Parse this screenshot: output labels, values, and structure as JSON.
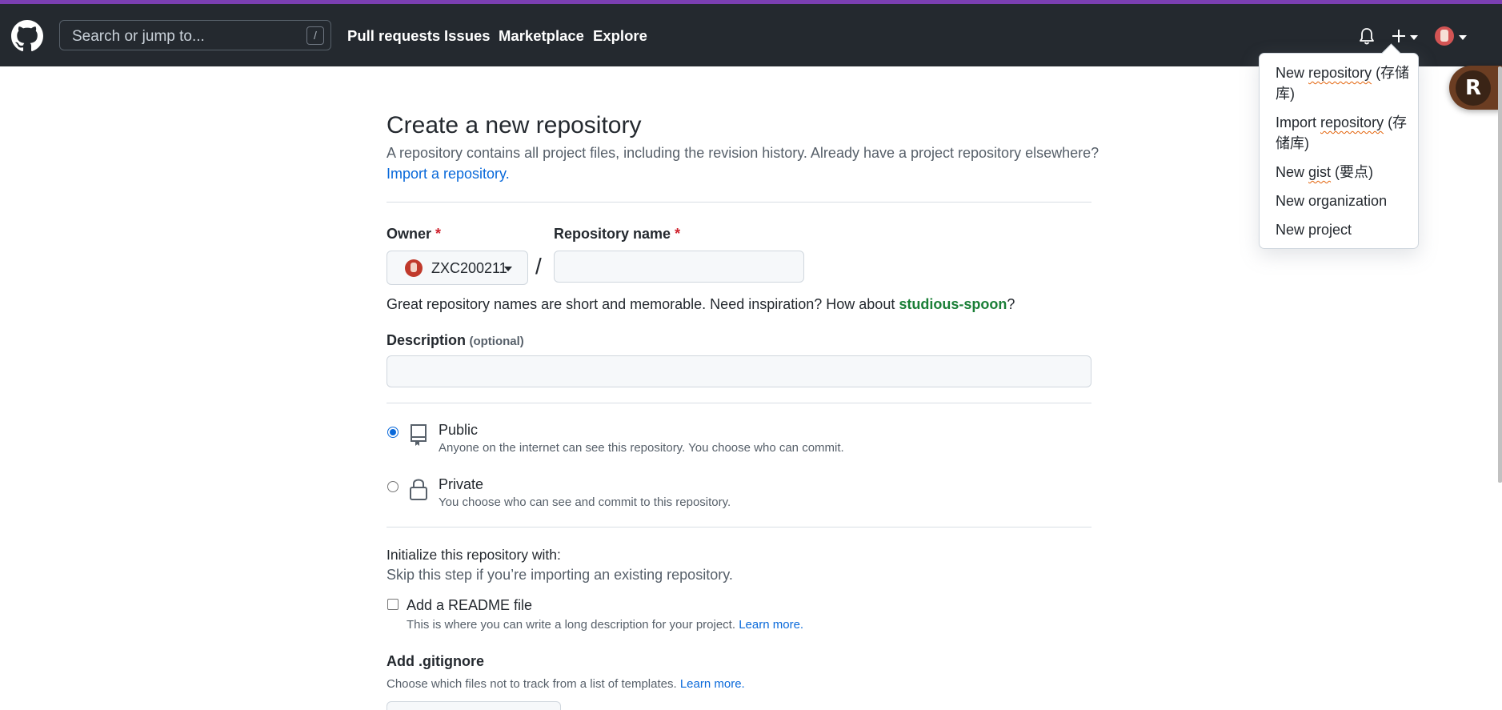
{
  "colors": {
    "header_bg": "#24292f",
    "accent_stripe": "#7b3fb2",
    "link": "#0969da",
    "suggestion": "#1a7f37",
    "required": "#cf222e"
  },
  "header": {
    "search_placeholder": "Search or jump to...",
    "search_shortcut": "/",
    "nav": [
      "Pull requests",
      "Issues",
      "Marketplace",
      "Explore"
    ],
    "icons": [
      "github-logo-icon",
      "bell-icon",
      "plus-icon",
      "avatar"
    ]
  },
  "dropdown": {
    "items": [
      {
        "label": "New",
        "sq": "repository",
        "rest": " (存储库)"
      },
      {
        "label": "Import",
        "sq": "repository",
        "rest": " (存储库)"
      },
      {
        "label": "New",
        "sq": "gist",
        "rest": " (要点)"
      },
      {
        "label": "New organization",
        "sq": "",
        "rest": ""
      },
      {
        "label": "New project",
        "sq": "",
        "rest": ""
      }
    ]
  },
  "badge": {
    "letter": "R"
  },
  "main": {
    "title": "Create a new repository",
    "subtitle": "A repository contains all project files, including the revision history. Already have a project repository elsewhere?",
    "import_link": "Import a repository.",
    "owner_label": "Owner",
    "repo_label": "Repository name",
    "required_mark": "*",
    "owner_name": "ZXC200211",
    "slash": "/",
    "repo_value": "",
    "hint_prefix": "Great repository names are short and memorable. Need inspiration? How about ",
    "hint_suggestion": "studious-spoon",
    "hint_suffix": "?",
    "description_label": "Description",
    "description_optional": "(optional)",
    "description_value": "",
    "visibility": {
      "public_label": "Public",
      "public_desc": "Anyone on the internet can see this repository. You choose who can commit.",
      "private_label": "Private",
      "private_desc": "You choose who can see and commit to this repository.",
      "selected": "public"
    },
    "init_title": "Initialize this repository with:",
    "init_sub": "Skip this step if you’re importing an existing repository.",
    "readme_label": "Add a README file",
    "readme_desc": "This is where you can write a long description for your project.",
    "learn_more": "Learn more.",
    "gitignore_title": "Add .gitignore",
    "gitignore_desc": "Choose which files not to track from a list of templates."
  }
}
